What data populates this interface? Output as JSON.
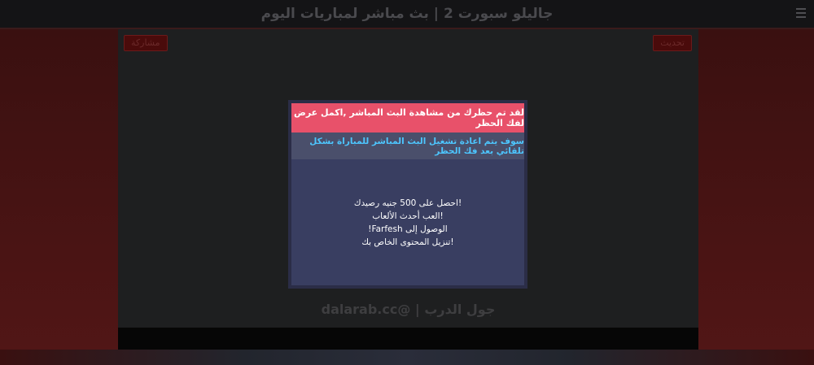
{
  "header": {
    "title": "جاليلو سبورت 2 | بث مباشر لمباريات اليوم"
  },
  "content": {
    "share_label": "مشاركة",
    "update_label": "تحديث",
    "tagline": "جول الدرب | @dalarab.cc"
  },
  "modal": {
    "alert_text": "لقد تم حظرك من مشاهدة البث المباشر ,اكمل عرض لفك الحظر",
    "info_text": "سوف يتم اعادة تشغيل البث المباشر للمباراة بشكل تلقائي بعد فك الحظر",
    "offers": [
      "!احصل على 500 جنيه رصيدك",
      "!العب أحدث الألعاب",
      "الوصول إلى Farfesh!",
      "!تنزيل المحتوى الخاص بك"
    ]
  },
  "colors": {
    "alert_bg": "#e8516a",
    "info_text": "#4dc6ff",
    "modal_body_bg": "#393e61"
  }
}
